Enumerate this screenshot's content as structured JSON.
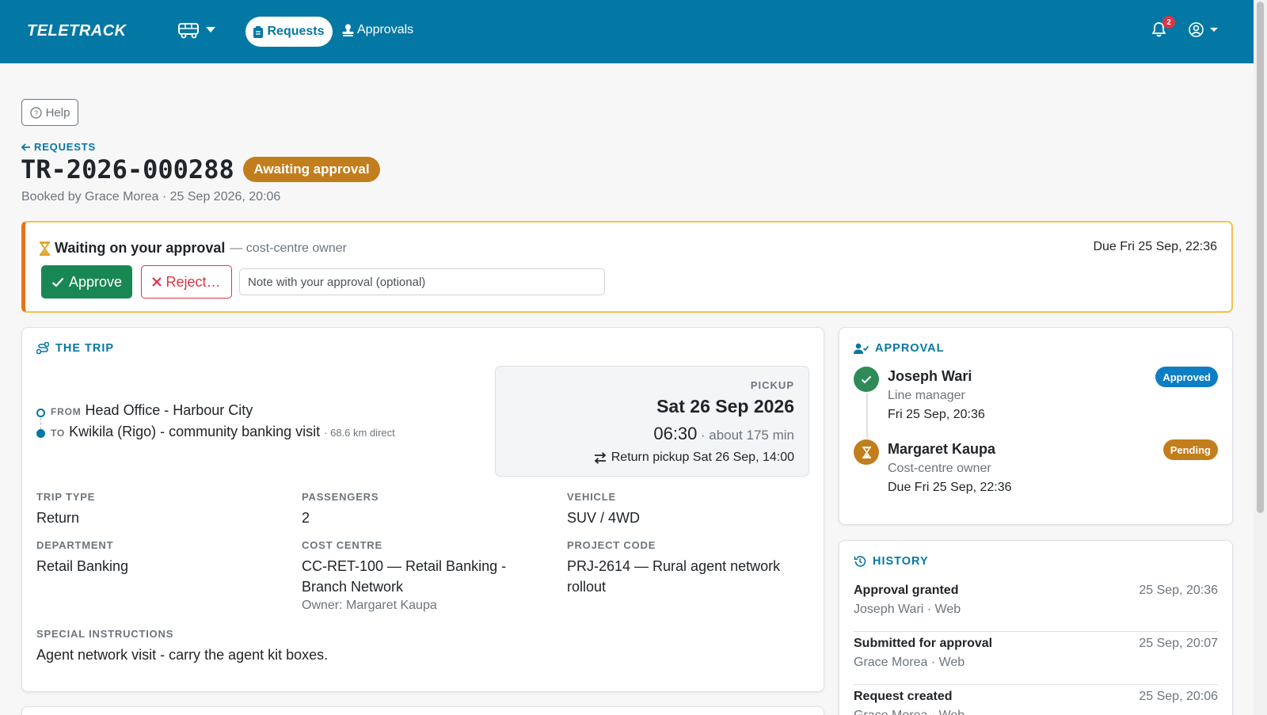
{
  "nav": {
    "brand": "TELETRACK",
    "requests_label": "Requests",
    "approvals_label": "Approvals",
    "notification_count": "2"
  },
  "help_label": "Help",
  "back_label": "REQUESTS",
  "request": {
    "id": "TR-2026-000288",
    "status": "Awaiting approval",
    "booked_by": "Booked by Grace Morea · 25 Sep 2026, 20:06"
  },
  "banner": {
    "title": "Waiting on your approval",
    "subtitle": "— cost-centre owner",
    "due": "Due Fri 25 Sep, 22:36",
    "approve_label": "Approve",
    "reject_label": "Reject…",
    "note_placeholder": "Note with your approval (optional)"
  },
  "trip": {
    "heading": "THE TRIP",
    "from_label": "FROM",
    "from": "Head Office - Harbour City",
    "to_label": "TO",
    "to": "Kwikila (Rigo) - community banking visit",
    "distance": "· 68.6 km direct",
    "pickup_label": "PICKUP",
    "pickup_date": "Sat 26 Sep 2026",
    "pickup_time": "06:30",
    "duration": "· about 175 min",
    "return_pickup": "Return pickup Sat 26 Sep, 14:00",
    "fields": {
      "trip_type_label": "TRIP TYPE",
      "trip_type": "Return",
      "passengers_label": "PASSENGERS",
      "passengers": "2",
      "vehicle_label": "VEHICLE",
      "vehicle": "SUV / 4WD",
      "department_label": "DEPARTMENT",
      "department": "Retail Banking",
      "cost_centre_label": "COST CENTRE",
      "cost_centre": "CC-RET-100 — Retail Banking - Branch Network",
      "cost_centre_owner": "Owner: Margaret Kaupa",
      "project_code_label": "PROJECT CODE",
      "project_code": "PRJ-2614 — Rural agent network rollout",
      "special_label": "SPECIAL INSTRUCTIONS",
      "special": "Agent network visit - carry the agent kit boxes."
    }
  },
  "approval": {
    "heading": "APPROVAL",
    "approvers": [
      {
        "name": "Joseph Wari",
        "role": "Line manager",
        "date": "Fri 25 Sep, 20:36",
        "status": "Approved",
        "color": "#0d7ec4"
      },
      {
        "name": "Margaret Kaupa",
        "role": "Cost-centre owner",
        "date": "Due Fri 25 Sep, 22:36",
        "status": "Pending",
        "color": "#c27e1c"
      }
    ]
  },
  "history": {
    "heading": "HISTORY",
    "items": [
      {
        "title": "Approval granted",
        "sub": "Joseph Wari · Web",
        "time": "25 Sep, 20:36"
      },
      {
        "title": "Submitted for approval",
        "sub": "Grace Morea · Web",
        "time": "25 Sep, 20:07"
      },
      {
        "title": "Request created",
        "sub": "Grace Morea · Web",
        "time": "25 Sep, 20:06"
      }
    ]
  },
  "colors": {
    "brand": "#0478a4",
    "success": "#198754",
    "danger": "#dc3545",
    "warning": "#c27e1c"
  }
}
